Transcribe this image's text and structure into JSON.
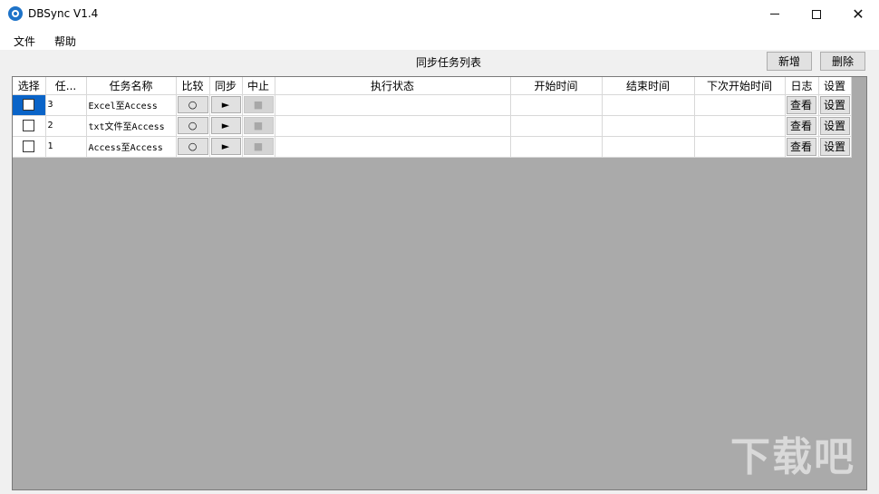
{
  "window": {
    "title": "DBSync V1.4",
    "controls": {
      "minimize_icon": "minimize-icon",
      "maximize_icon": "maximize-icon",
      "close_icon": "close-icon"
    }
  },
  "menu": {
    "file": "文件",
    "help": "帮助"
  },
  "toolbar": {
    "list_title": "同步任务列表",
    "add_label": "新增",
    "delete_label": "删除"
  },
  "table": {
    "headers": [
      "选择",
      "任...",
      "任务名称",
      "比较",
      "同步",
      "中止",
      "执行状态",
      "开始时间",
      "结束时间",
      "下次开始时间",
      "日志",
      "设置"
    ],
    "rows": [
      {
        "selected": false,
        "id": "3",
        "name": "Excel至Access",
        "compare": "○",
        "sync": "►",
        "stop": "■",
        "status": "",
        "start": "",
        "end": "",
        "next": "",
        "log": "查看",
        "settings": "设置"
      },
      {
        "selected": false,
        "id": "2",
        "name": "txt文件至Access",
        "compare": "○",
        "sync": "►",
        "stop": "■",
        "status": "",
        "start": "",
        "end": "",
        "next": "",
        "log": "查看",
        "settings": "设置"
      },
      {
        "selected": false,
        "id": "1",
        "name": "Access至Access",
        "compare": "○",
        "sync": "►",
        "stop": "■",
        "status": "",
        "start": "",
        "end": "",
        "next": "",
        "log": "查看",
        "settings": "设置"
      }
    ]
  },
  "watermark": "下载吧"
}
